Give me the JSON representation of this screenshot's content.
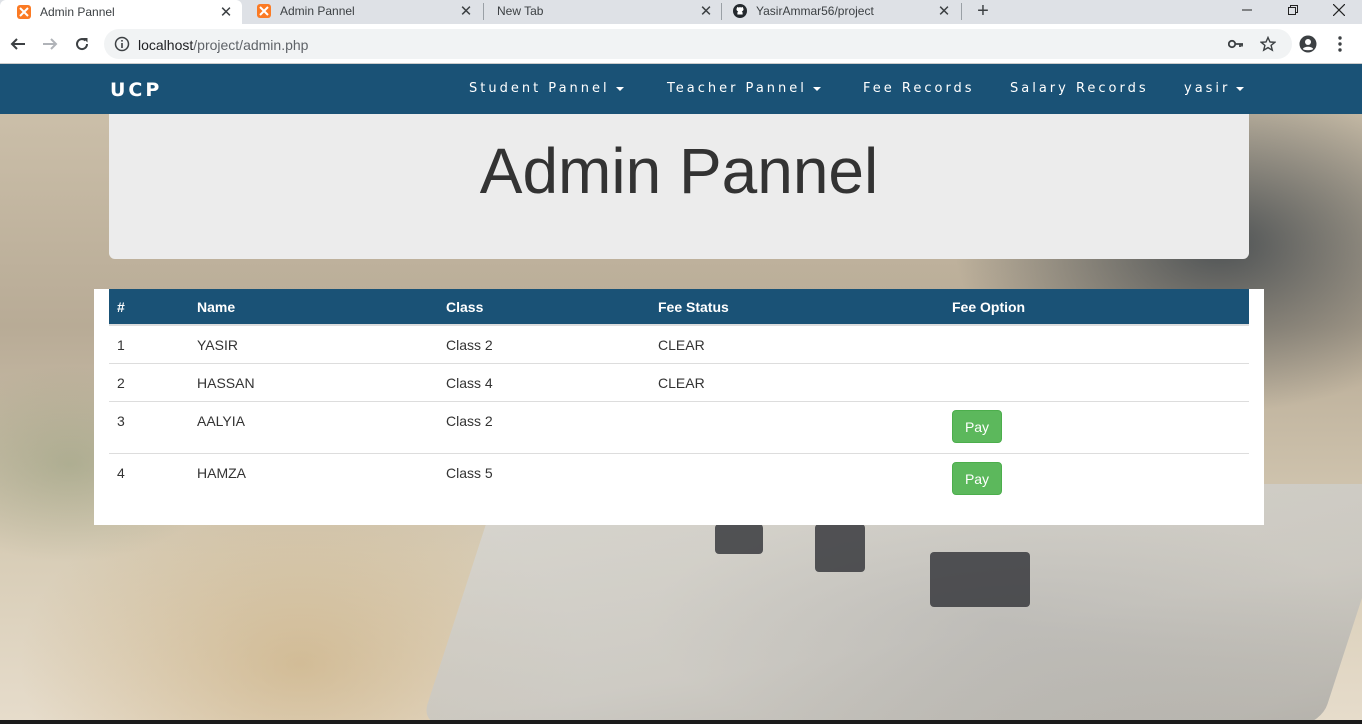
{
  "browser": {
    "tabs": [
      {
        "title": "Admin Pannel",
        "icon": "xampp-icon",
        "active": true
      },
      {
        "title": "Admin Pannel",
        "icon": "xampp-icon",
        "active": false
      },
      {
        "title": "New Tab",
        "icon": "",
        "active": false
      },
      {
        "title": "YasirAmmar56/project",
        "icon": "github-icon",
        "active": false
      }
    ],
    "url_host": "localhost",
    "url_path": "/project/admin.php"
  },
  "navbar": {
    "brand": "UCP",
    "items": [
      {
        "label": "Student Pannel",
        "dropdown": true
      },
      {
        "label": "Teacher Pannel",
        "dropdown": true
      },
      {
        "label": "Fee Records",
        "dropdown": false
      },
      {
        "label": "Salary Records",
        "dropdown": false
      },
      {
        "label": "yasir",
        "dropdown": true
      }
    ]
  },
  "jumbotron": {
    "title": "Admin Pannel"
  },
  "table": {
    "headers": [
      "#",
      "Name",
      "Class",
      "Fee Status",
      "Fee Option"
    ],
    "rows": [
      {
        "num": "1",
        "name": "YASIR",
        "class": "Class 2",
        "status": "CLEAR",
        "option": ""
      },
      {
        "num": "2",
        "name": "HASSAN",
        "class": "Class 4",
        "status": "CLEAR",
        "option": ""
      },
      {
        "num": "3",
        "name": "AALYIA",
        "class": "Class 2",
        "status": "",
        "option": "Pay"
      },
      {
        "num": "4",
        "name": "HAMZA",
        "class": "Class 5",
        "status": "",
        "option": "Pay"
      }
    ]
  },
  "colors": {
    "navbar": "#1a5276",
    "pay_button": "#5cb85c",
    "jumbotron": "#ececec"
  }
}
